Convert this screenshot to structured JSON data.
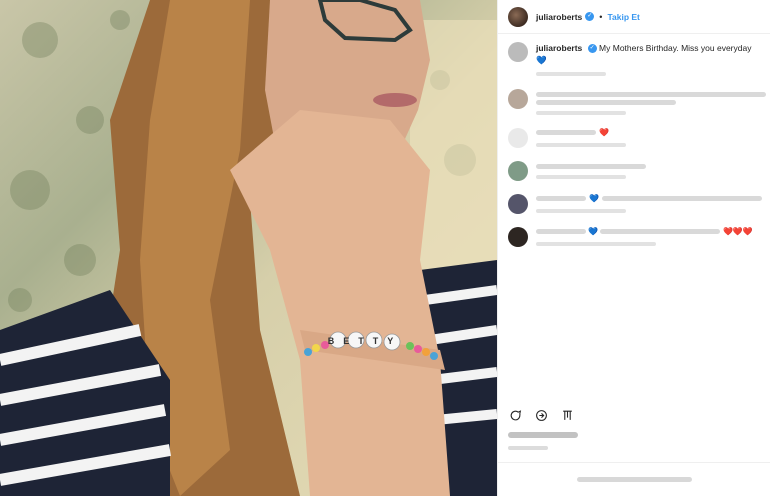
{
  "post": {
    "author": "juliaroberts",
    "follow_label": "Takip Et",
    "separator": "•",
    "caption": "My Mothers Birthday. Miss you everyday",
    "caption_emoji": "💙",
    "bracelet_text": "BETTY"
  },
  "comments_emoji": {
    "c2": "❤️",
    "c4": "💙",
    "c5_a": "💙",
    "c5_b": "❤️❤️❤️"
  },
  "colors": {
    "accent": "#3897f0",
    "verified": "#3897f0"
  },
  "icons": [
    "comment-icon",
    "share-icon",
    "bookmark-icon",
    "verified-icon"
  ]
}
